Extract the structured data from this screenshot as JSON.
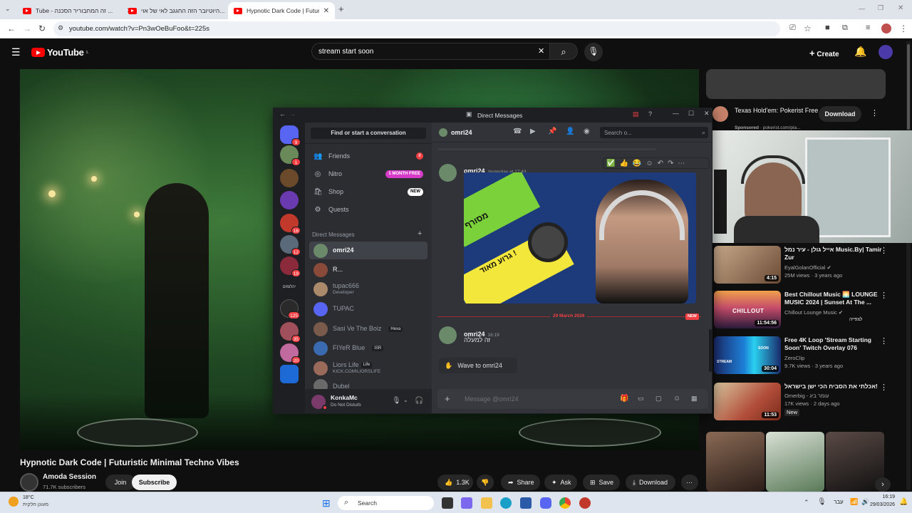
{
  "browser": {
    "tabs": [
      {
        "title": "Tube - זה המחבוריר הסכנה ...",
        "active": false
      },
      {
        "title": "היוטיובר הזה החגגב לאי של אוי...",
        "active": false
      },
      {
        "title": "Hypnotic Dark Code | Futuristic",
        "active": true
      }
    ],
    "new_tab": "+",
    "url": "youtube.com/watch?v=Pn3wOeBuFoo&t=225s"
  },
  "youtube": {
    "logo_text": "YouTube",
    "region": "IL",
    "search_value": "stream start soon",
    "create_label": "Create",
    "video_title": "Hypnotic Dark Code | Futuristic Minimal Techno Vibes",
    "channel_name": "Amoda Session",
    "subscribers": "71.7K subscribers",
    "join_label": "Join",
    "subscribe_label": "Subscribe",
    "likes": "1.3K",
    "share_label": "Share",
    "ask_label": "Ask",
    "save_label": "Save",
    "download_label": "Download",
    "ad": {
      "title": "Texas Hold'em: Pokerist Free",
      "sponsored": "Sponsored",
      "domain": "pokerist.com/pla...",
      "button": "Download"
    },
    "recommendations": [
      {
        "title": "אייל גולן - עיר נמל Music.By| Tamir Zur",
        "channel": "EyalGolanOfficial",
        "meta": "25M views · 3 years ago",
        "duration": "4:15",
        "badge": ""
      },
      {
        "title": "Best Chillout Music 🌅 LOUNGE MUSIC 2024 | Sunset At The ...",
        "channel": "Chillout Lounge Music",
        "meta": "",
        "duration": "11:54:56",
        "badge": ""
      },
      {
        "title": "Free 4K Loop 'Stream Starting Soon' Twitch Overlay 076",
        "channel": "ZeroClip",
        "meta": "9.7K views · 3 years ago",
        "duration": "30:04",
        "badge": ""
      },
      {
        "title": "אכלתי את הסביח הכי ישן בישראל!",
        "channel": "Omerbig - עומר ביג",
        "meta": "17K views · 2 days ago",
        "duration": "11:53",
        "badge": "New"
      }
    ],
    "chillout_overlay_text": "CHILLOUT",
    "chillout_extra": "לצפייה",
    "stream_overlay_text": "STREAM",
    "soon_overlay_text": "SOON"
  },
  "discord": {
    "window_title": "Direct Messages",
    "find_placeholder": "Find or start a conversation",
    "nav": [
      {
        "label": "Friends",
        "icon": "friends-icon",
        "badge": "8"
      },
      {
        "label": "Nitro",
        "icon": "nitro-icon",
        "badge": "1 MONTH FREE"
      },
      {
        "label": "Shop",
        "icon": "shop-icon",
        "badge": "NEW"
      },
      {
        "label": "Quests",
        "icon": "quests-icon",
        "badge": ""
      }
    ],
    "dm_header": "Direct Messages",
    "dms": [
      {
        "name": "omri24",
        "sub": "",
        "tag": "",
        "selected": true
      },
      {
        "name": "R...",
        "sub": "",
        "tag": "",
        "selected": false
      },
      {
        "name": "tupac666",
        "sub": "Developer",
        "tag": "",
        "selected": false
      },
      {
        "name": "TUPAC",
        "sub": "",
        "tag": "",
        "selected": false
      },
      {
        "name": "Sasi Ve The Boiz",
        "sub": "",
        "tag": "Hexa",
        "selected": false
      },
      {
        "name": "FIYeR Blue",
        "sub": "",
        "tag": "ISR",
        "selected": false
      },
      {
        "name": "Liors Life",
        "sub": "KICK.COM\\LIORSLIFE",
        "tag": "Life",
        "selected": false
      },
      {
        "name": "Dubel",
        "sub": "",
        "tag": "",
        "selected": false
      }
    ],
    "guild_badges": [
      "9",
      "1",
      "",
      "",
      "16",
      "12",
      "19",
      "",
      "125",
      "35",
      "20",
      ""
    ],
    "guild_text": "יהלומים",
    "user": {
      "name": "KonkaMc",
      "status": "Do Not Disturb"
    },
    "chat": {
      "recipient": "omri24",
      "search_placeholder": "Search o...",
      "message1": {
        "author": "omri24",
        "time": "Yesterday at 17:43"
      },
      "image_text_top": "מסורף",
      "image_text_bottom": "גרוע מאוד !",
      "date_divider": "29 March 2026",
      "new_label": "NEW",
      "message2": {
        "author": "omri24",
        "time": "16:19",
        "text": "זה למעלה"
      },
      "wave_label": "Wave to omri24",
      "input_placeholder": "Message @omri24"
    }
  },
  "taskbar": {
    "weather_temp": "18°C",
    "weather_desc": "מעונן חלקית",
    "search_label": "Search",
    "lang": "עבר",
    "time": "16:19",
    "date": "29/03/2026"
  },
  "colors": {
    "youtube_red": "#ff0000",
    "discord_blurple": "#5865f2",
    "dnd_red": "#f23f43",
    "nitro_pink": "#d63ac9"
  }
}
